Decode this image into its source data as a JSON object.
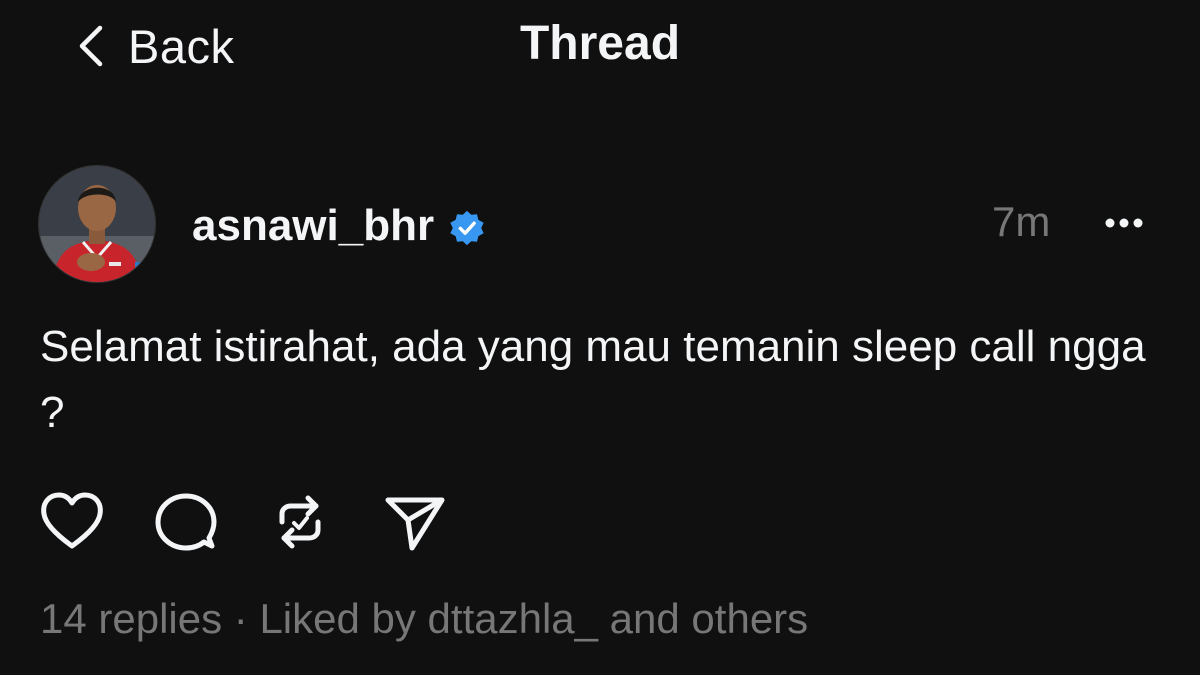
{
  "header": {
    "back_label": "Back",
    "title": "Thread"
  },
  "post": {
    "username": "asnawi_bhr",
    "verified_icon": "verified-badge-icon",
    "verified_color": "#3897f0",
    "timestamp": "7m",
    "more_icon": "more-horizontal-icon",
    "text": "Selamat istirahat, ada yang mau temanin sleep call ngga ?",
    "actions": {
      "like_icon": "heart-icon",
      "reply_icon": "comment-bubble-icon",
      "repost_icon": "repost-icon",
      "share_icon": "send-icon"
    },
    "stats": {
      "replies": "14 replies",
      "separator": "·",
      "liked_by": "Liked by dttazhla_ and others"
    }
  },
  "colors": {
    "background": "#101010",
    "text_primary": "#f3f5f7",
    "text_secondary": "#777777"
  }
}
